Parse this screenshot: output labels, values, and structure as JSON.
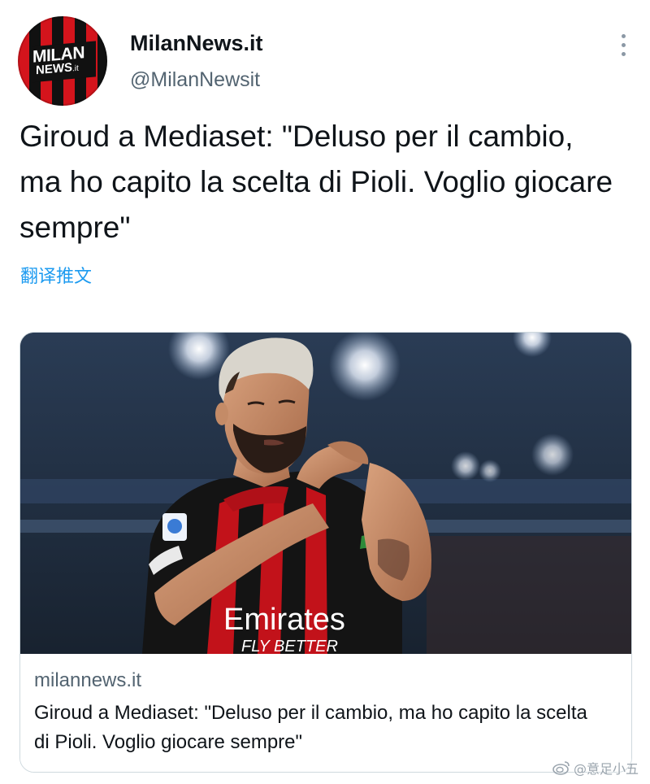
{
  "account": {
    "display_name": "MilanNews.it",
    "handle": "@MilanNewsit",
    "avatar_logo_top": "MILAN",
    "avatar_logo_bottom": "NEWS",
    "avatar_logo_suffix": ".it"
  },
  "tweet": {
    "text": "Giroud a Mediaset: \"Deluso per il cambio, ma ho capito la scelta di Pioli. Voglio giocare sempre\"",
    "translate_label": "翻译推文"
  },
  "card": {
    "domain": "milannews.it",
    "title": "Giroud a Mediaset: \"Deluso per il cambio, ma ho capito la scelta di Pioli. Voglio giocare sempre\"",
    "image_jersey_text": "Emirates",
    "image_jersey_subtext": "FLY BETTER"
  },
  "watermark": {
    "text": "@意足小五"
  },
  "icons": {
    "more": "more-vertical-icon",
    "weibo": "weibo-icon"
  },
  "colors": {
    "link": "#1d9bf0",
    "muted": "#536471",
    "border": "#cfd9de",
    "milan_red": "#d4141c"
  }
}
